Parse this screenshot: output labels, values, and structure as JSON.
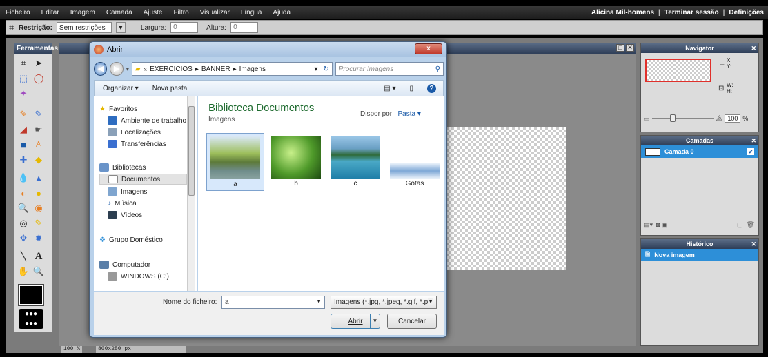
{
  "menubar": {
    "items": [
      "Ficheiro",
      "Editar",
      "Imagem",
      "Camada",
      "Ajuste",
      "Filtro",
      "Visualizar",
      "Língua",
      "Ajuda"
    ],
    "user": "Alicina Mil-homens",
    "logout": "Terminar sessão",
    "settings": "Definições",
    "separator": "|"
  },
  "options": {
    "restriction_label": "Restrição:",
    "restriction_value": "Sem restrições",
    "width_label": "Largura:",
    "width_value": "0",
    "height_label": "Altura:",
    "height_value": "0"
  },
  "tools": {
    "title": "Ferramentas"
  },
  "status": {
    "zoom": "100 %",
    "size": "800x250 px"
  },
  "navigator": {
    "title": "Navigator",
    "x_label": "X:",
    "y_label": "Y:",
    "w_label": "W:",
    "h_label": "H:",
    "zoom": "100",
    "unit": "%"
  },
  "layers": {
    "title": "Camadas",
    "items": [
      "Camada 0"
    ]
  },
  "history": {
    "title": "Histórico",
    "items": [
      "Nova imagem"
    ]
  },
  "dialog": {
    "title": "Abrir",
    "close": "x",
    "breadcrumb": [
      "«",
      "EXERCICIOS",
      "BANNER",
      "Imagens"
    ],
    "search_placeholder": "Procurar Imagens",
    "organize": "Organizar ▾",
    "new_folder": "Nova pasta",
    "nav": {
      "favorites": "Favoritos",
      "desktop": "Ambiente de trabalho",
      "places": "Localizações",
      "downloads": "Transferências",
      "libraries": "Bibliotecas",
      "documents": "Documentos",
      "images": "Imagens",
      "music": "Música",
      "videos": "Vídeos",
      "homegroup": "Grupo Doméstico",
      "computer": "Computador",
      "windows": "WINDOWS (C:)"
    },
    "library_title": "Biblioteca Documentos",
    "library_sub": "Imagens",
    "arrange_label": "Dispor por:",
    "arrange_value": "Pasta ▾",
    "files": [
      "a",
      "b",
      "c",
      "Gotas"
    ],
    "filename_label": "Nome do ficheiro:",
    "filename_value": "a",
    "filetype": "Imagens (*.jpg, *.jpeg, *.gif, *.p",
    "open": "Abrir",
    "cancel": "Cancelar"
  }
}
